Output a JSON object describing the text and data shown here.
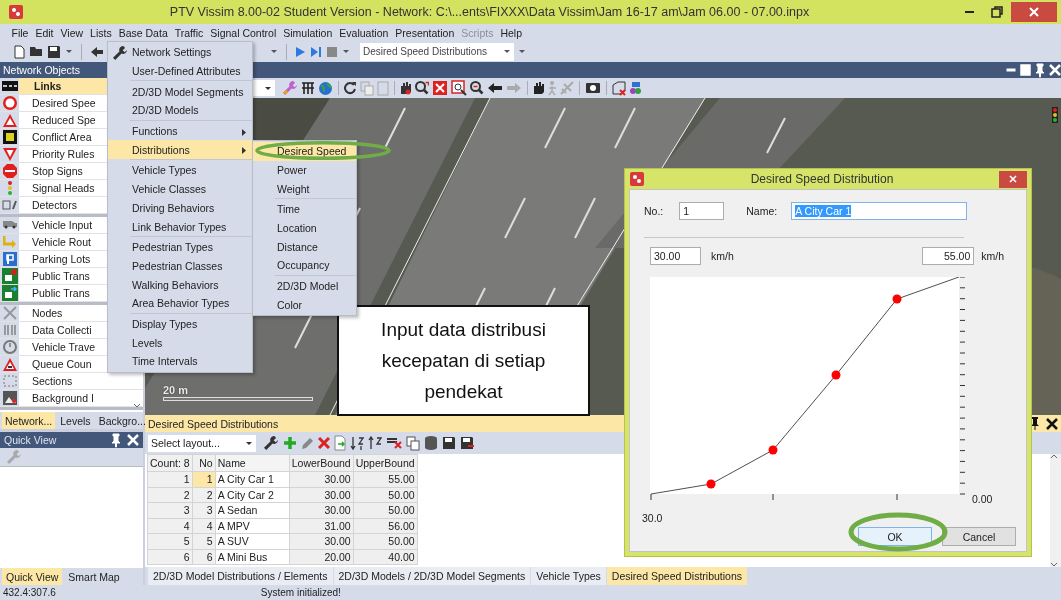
{
  "window": {
    "title": "PTV Vissim 8.00-02 Student Version - Network: C:\\...ents\\FIXXX\\Data Vissim\\Jam 16-17 am\\Jam 06.00 - 07.00.inpx"
  },
  "menu_bar": [
    {
      "label": "File",
      "disabled": false
    },
    {
      "label": "Edit",
      "disabled": false
    },
    {
      "label": "View",
      "disabled": false
    },
    {
      "label": "Lists",
      "disabled": false
    },
    {
      "label": "Base Data",
      "disabled": false
    },
    {
      "label": "Traffic",
      "disabled": false
    },
    {
      "label": "Signal Control",
      "disabled": false
    },
    {
      "label": "Simulation",
      "disabled": false
    },
    {
      "label": "Evaluation",
      "disabled": false
    },
    {
      "label": "Presentation",
      "disabled": false
    },
    {
      "label": "Scripts",
      "disabled": true
    },
    {
      "label": "Help",
      "disabled": false
    }
  ],
  "toolbar": {
    "list_dropdown": "Desired Speed Distributions"
  },
  "base_data_menu": {
    "sections": [
      [
        {
          "label": "Network Settings",
          "selected": false,
          "submenu": false
        },
        {
          "label": "User-Defined Attributes",
          "selected": false,
          "submenu": false
        }
      ],
      [
        {
          "label": "2D/3D Model Segments",
          "selected": false,
          "submenu": false
        },
        {
          "label": "2D/3D Models",
          "selected": false,
          "submenu": false
        }
      ],
      [
        {
          "label": "Functions",
          "selected": false,
          "submenu": true
        },
        {
          "label": "Distributions",
          "selected": true,
          "submenu": true
        }
      ],
      [
        {
          "label": "Vehicle Types",
          "selected": false,
          "submenu": false
        },
        {
          "label": "Vehicle Classes",
          "selected": false,
          "submenu": false
        },
        {
          "label": "Driving Behaviors",
          "selected": false,
          "submenu": false
        },
        {
          "label": "Link Behavior Types",
          "selected": false,
          "submenu": false
        }
      ],
      [
        {
          "label": "Pedestrian Types",
          "selected": false,
          "submenu": false
        },
        {
          "label": "Pedestrian Classes",
          "selected": false,
          "submenu": false
        },
        {
          "label": "Walking Behaviors",
          "selected": false,
          "submenu": false
        },
        {
          "label": "Area Behavior Types",
          "selected": false,
          "submenu": false
        }
      ],
      [
        {
          "label": "Display Types",
          "selected": false,
          "submenu": false
        },
        {
          "label": "Levels",
          "selected": false,
          "submenu": false
        },
        {
          "label": "Time Intervals",
          "selected": false,
          "submenu": false
        }
      ]
    ]
  },
  "distributions_submenu": {
    "sections": [
      [
        {
          "label": "Desired Speed",
          "selected": true
        },
        {
          "label": "Power",
          "selected": false
        },
        {
          "label": "Weight",
          "selected": false
        }
      ],
      [
        {
          "label": "Time",
          "selected": false
        },
        {
          "label": "Location",
          "selected": false
        },
        {
          "label": "Distance",
          "selected": false
        },
        {
          "label": "Occupancy",
          "selected": false
        }
      ],
      [
        {
          "label": "2D/3D Model",
          "selected": false
        },
        {
          "label": "Color",
          "selected": false
        }
      ]
    ]
  },
  "network_objects": {
    "title": "Network Objects",
    "groups": [
      [
        {
          "label": "Links",
          "selected": true
        },
        {
          "label": "Desired Spee",
          "selected": false
        },
        {
          "label": "Reduced Spe",
          "selected": false
        },
        {
          "label": "Conflict Area",
          "selected": false
        },
        {
          "label": "Priority Rules",
          "selected": false
        },
        {
          "label": "Stop Signs",
          "selected": false
        },
        {
          "label": "Signal Heads",
          "selected": false
        },
        {
          "label": "Detectors",
          "selected": false
        }
      ],
      [
        {
          "label": "Vehicle Input",
          "selected": false
        },
        {
          "label": "Vehicle Rout",
          "selected": false
        },
        {
          "label": "Parking Lots",
          "selected": false
        },
        {
          "label": "Public Trans",
          "selected": false
        },
        {
          "label": "Public Trans",
          "selected": false
        }
      ],
      [
        {
          "label": "Nodes",
          "selected": false
        },
        {
          "label": "Data Collecti",
          "selected": false
        },
        {
          "label": "Vehicle Trave",
          "selected": false
        },
        {
          "label": "Queue Coun",
          "selected": false
        },
        {
          "label": "Sections",
          "selected": false
        },
        {
          "label": "Background I",
          "selected": false
        }
      ]
    ],
    "tabs": [
      {
        "label": "Network...",
        "selected": true
      },
      {
        "label": "Levels",
        "selected": false
      },
      {
        "label": "Backgro...",
        "selected": false
      }
    ]
  },
  "quick_view": {
    "title": "Quick View",
    "tabs": [
      {
        "label": "Quick View",
        "selected": true
      },
      {
        "label": "Smart Map",
        "selected": false
      }
    ]
  },
  "map": {
    "scale_label": "20 m"
  },
  "annotation": "Input data distribusi kecepatan di setiap pendekat",
  "list_panel": {
    "title": "Desired Speed Distributions",
    "layout_select": "Select layout...",
    "columns": [
      "Count: 8",
      "No",
      "Name",
      "LowerBound",
      "UpperBound"
    ],
    "rows": [
      {
        "cells": [
          "1",
          "1",
          "A City Car 1",
          "30.00",
          "55.00"
        ],
        "selected": true
      },
      {
        "cells": [
          "2",
          "2",
          "A City Car 2",
          "30.00",
          "50.00"
        ],
        "selected": false
      },
      {
        "cells": [
          "3",
          "3",
          "A Sedan",
          "30.00",
          "50.00"
        ],
        "selected": false
      },
      {
        "cells": [
          "4",
          "4",
          "A MPV",
          "31.00",
          "56.00"
        ],
        "selected": false
      },
      {
        "cells": [
          "5",
          "5",
          "A SUV",
          "30.00",
          "50.00"
        ],
        "selected": false
      },
      {
        "cells": [
          "6",
          "6",
          "A Mini Bus",
          "20.00",
          "40.00"
        ],
        "selected": false
      }
    ],
    "tabs": [
      {
        "label": "2D/3D Model Distributions / Elements",
        "selected": false
      },
      {
        "label": "2D/3D Models / 2D/3D Model Segments",
        "selected": false
      },
      {
        "label": "Vehicle Types",
        "selected": false
      },
      {
        "label": "Desired Speed Distributions",
        "selected": true
      }
    ]
  },
  "dialog": {
    "title": "Desired Speed Distribution",
    "number_label": "No.:",
    "number": "1",
    "name_label": "Name:",
    "name": "A City Car 1",
    "name_selected": true,
    "lower_speed": "30.00",
    "lower_unit": "km/h",
    "upper_speed": "55.00",
    "upper_unit": "km/h",
    "y_axis_label": "0.00",
    "x_axis_label": "30.0",
    "buttons": [
      {
        "label": "OK",
        "kind": "default"
      },
      {
        "label": "Cancel",
        "kind": "normal"
      }
    ]
  },
  "status_bar": {
    "coordinates": "432.4:307.6",
    "message": "System initialized!"
  }
}
